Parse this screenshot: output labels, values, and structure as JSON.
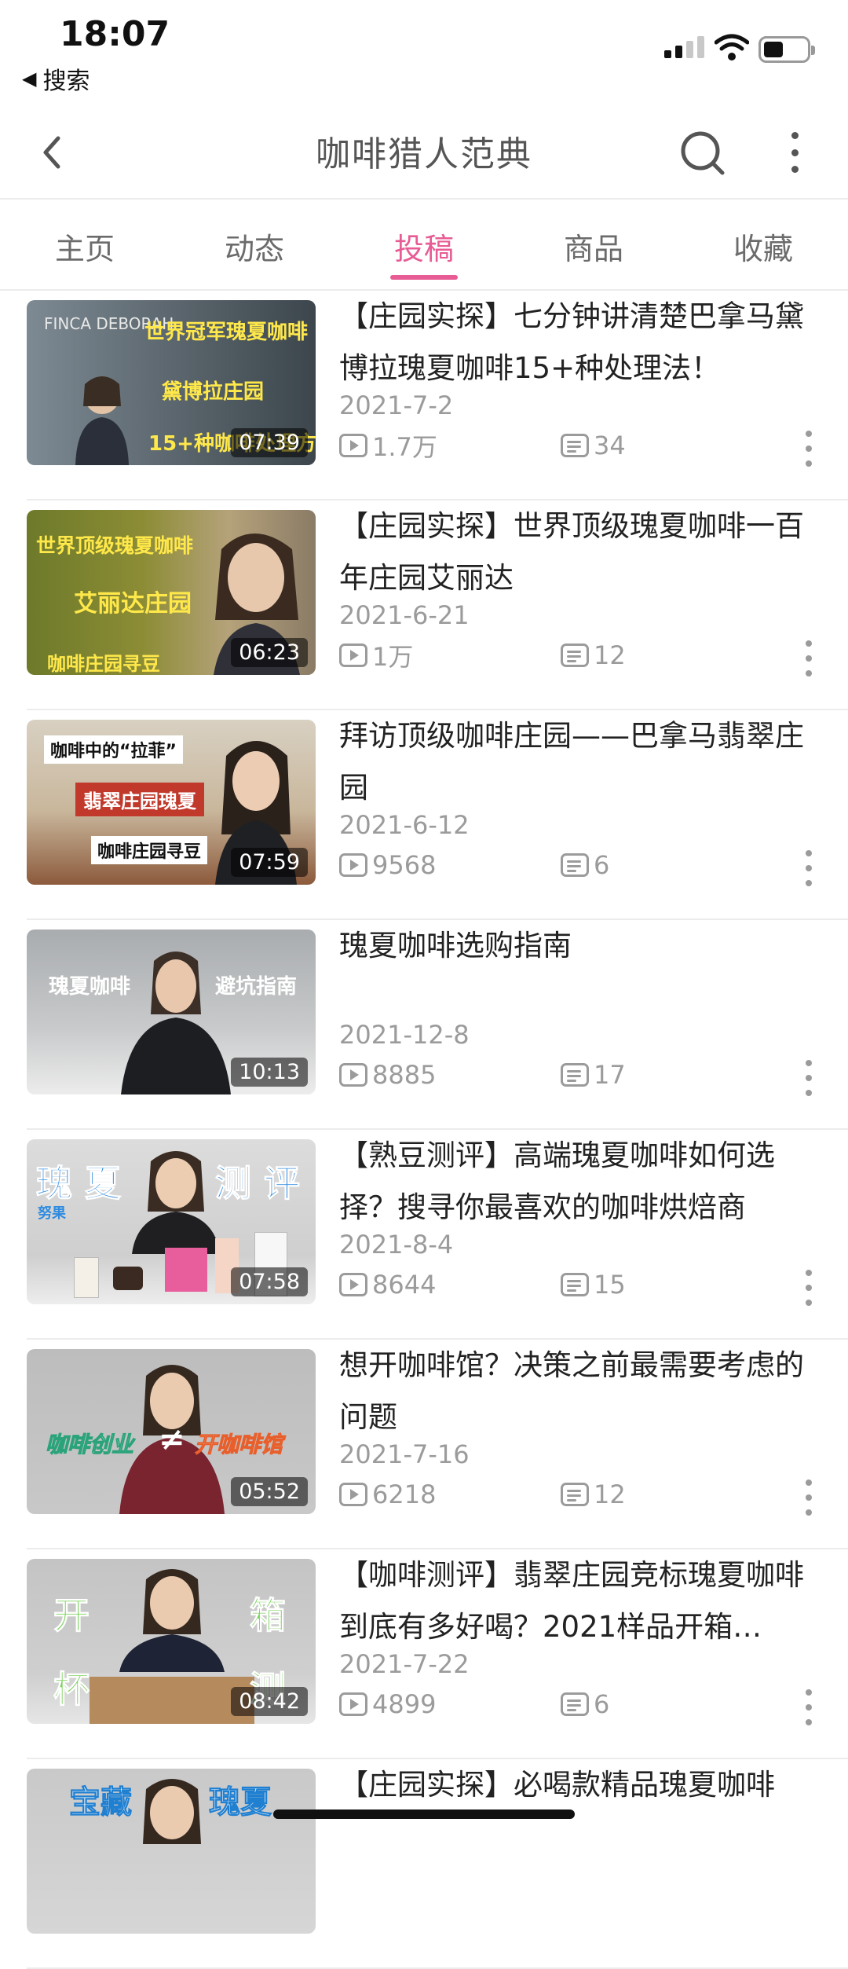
{
  "status_bar": {
    "time": "18:07",
    "back_app": "搜索",
    "battery_level": 0.45
  },
  "header": {
    "title": "咖啡猎人范典"
  },
  "tabs": [
    {
      "label": "主页",
      "active": false
    },
    {
      "label": "动态",
      "active": false
    },
    {
      "label": "投稿",
      "active": true
    },
    {
      "label": "商品",
      "active": false
    },
    {
      "label": "收藏",
      "active": false
    }
  ],
  "accent_color": "#e75c94",
  "videos": [
    {
      "title": "【庄园实探】七分钟讲清楚巴拿马黛博拉瑰夏咖啡15+种处理法！",
      "date": "2021-7-2",
      "plays": "1.7万",
      "comments": "34",
      "duration": "07:39",
      "thumb_text": [
        "FINCA DEBORAH",
        "世界冠军瑰夏咖啡",
        "黛博拉庄园",
        "15+种咖啡处理方法"
      ]
    },
    {
      "title": "【庄园实探】世界顶级瑰夏咖啡一百年庄园艾丽达",
      "date": "2021-6-21",
      "plays": "1万",
      "comments": "12",
      "duration": "06:23",
      "thumb_text": [
        "世界顶级瑰夏咖啡",
        "艾丽达庄园",
        "咖啡庄园寻豆"
      ]
    },
    {
      "title": "拜访顶级咖啡庄园——巴拿马翡翠庄园",
      "date": "2021-6-12",
      "plays": "9568",
      "comments": "6",
      "duration": "07:59",
      "thumb_text": [
        "咖啡中的“拉菲”",
        "翡翠庄园瑰夏",
        "咖啡庄园寻豆"
      ]
    },
    {
      "title": "瑰夏咖啡选购指南",
      "date": "2021-12-8",
      "plays": "8885",
      "comments": "17",
      "duration": "10:13",
      "thumb_text": [
        "瑰夏咖啡",
        "避坑指南"
      ]
    },
    {
      "title": "【熟豆测评】高端瑰夏咖啡如何选择？搜寻你最喜欢的咖啡烘焙商",
      "date": "2021-8-4",
      "plays": "8644",
      "comments": "15",
      "duration": "07:58",
      "thumb_text": [
        "瑰 夏",
        "测 评",
        "努果"
      ]
    },
    {
      "title": "想开咖啡馆？决策之前最需要考虑的问题",
      "date": "2021-7-16",
      "plays": "6218",
      "comments": "12",
      "duration": "05:52",
      "thumb_text": [
        "咖啡创业",
        "≠",
        "开咖啡馆"
      ]
    },
    {
      "title": "【咖啡测评】翡翠庄园竞标瑰夏咖啡到底有多好喝？2021样品开箱…",
      "date": "2021-7-22",
      "plays": "4899",
      "comments": "6",
      "duration": "08:42",
      "thumb_text": [
        "开",
        "箱",
        "杯",
        "测"
      ]
    },
    {
      "title": "【庄园实探】必喝款精品瑰夏咖啡",
      "date": "",
      "plays": "",
      "comments": "",
      "duration": "",
      "thumb_text": [
        "宝藏",
        "瑰夏"
      ]
    }
  ]
}
